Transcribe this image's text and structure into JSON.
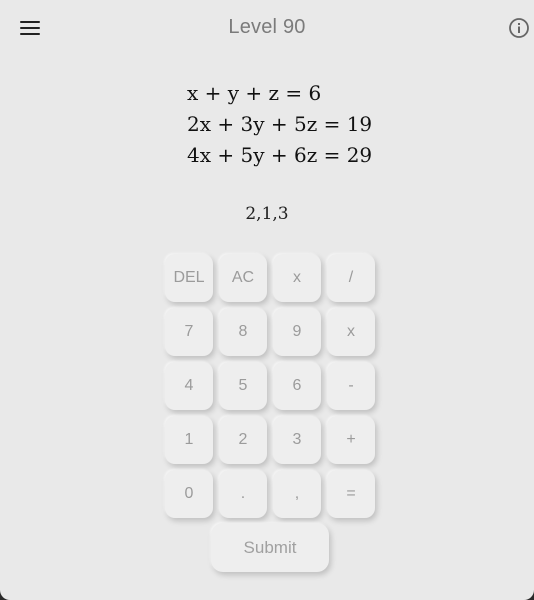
{
  "header": {
    "title": "Level 90",
    "menu_icon": "hamburger-menu-icon",
    "info_icon": "info-circle-icon"
  },
  "puzzle": {
    "equations": [
      "x + y + z = 6",
      "2x + 3y + 5z = 19",
      "4x + 5y + 6z = 29"
    ],
    "answer": "2,1,3"
  },
  "keypad": {
    "rows": [
      [
        "DEL",
        "AC",
        "x",
        "/"
      ],
      [
        "7",
        "8",
        "9",
        "x"
      ],
      [
        "4",
        "5",
        "6",
        "-"
      ],
      [
        "1",
        "2",
        "3",
        "+"
      ],
      [
        "0",
        ".",
        ",",
        "="
      ]
    ],
    "submit_label": "Submit"
  },
  "colors": {
    "background": "#e9e9e9",
    "key_background": "#eeeeee",
    "key_text": "#9b9b9b",
    "title_text": "#7b7b7b"
  }
}
